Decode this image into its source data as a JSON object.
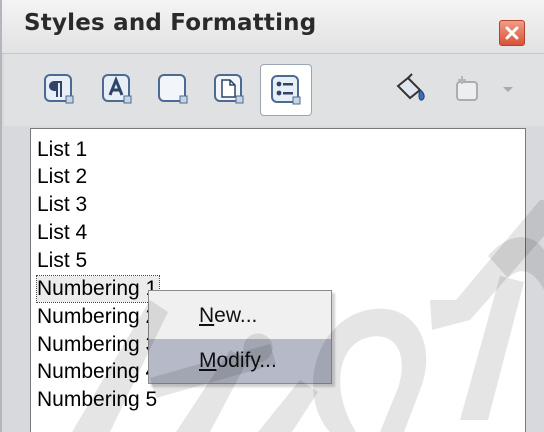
{
  "window": {
    "title": "Styles and Formatting"
  },
  "toolbar": {
    "buttons": [
      {
        "icon": "paragraph-styles-icon"
      },
      {
        "icon": "character-styles-icon"
      },
      {
        "icon": "frame-styles-icon"
      },
      {
        "icon": "page-styles-icon"
      },
      {
        "icon": "list-styles-icon",
        "active": true
      },
      {
        "icon": "fill-format-mode-icon"
      },
      {
        "icon": "new-style-from-selection-icon"
      }
    ]
  },
  "list": {
    "items": [
      "List 1",
      "List 2",
      "List 3",
      "List 4",
      "List 5",
      "Numbering 1",
      "Numbering 2",
      "Numbering 3",
      "Numbering 4",
      "Numbering 5"
    ],
    "selected_index": 5
  },
  "context_menu": {
    "new_accel": "N",
    "new_rest": "ew...",
    "modify_accel": "M",
    "modify_rest": "odify..."
  },
  "colors": {
    "close_button": "#d9523a",
    "menu_hover": "#b5b9c8",
    "watermark": "#000000"
  }
}
